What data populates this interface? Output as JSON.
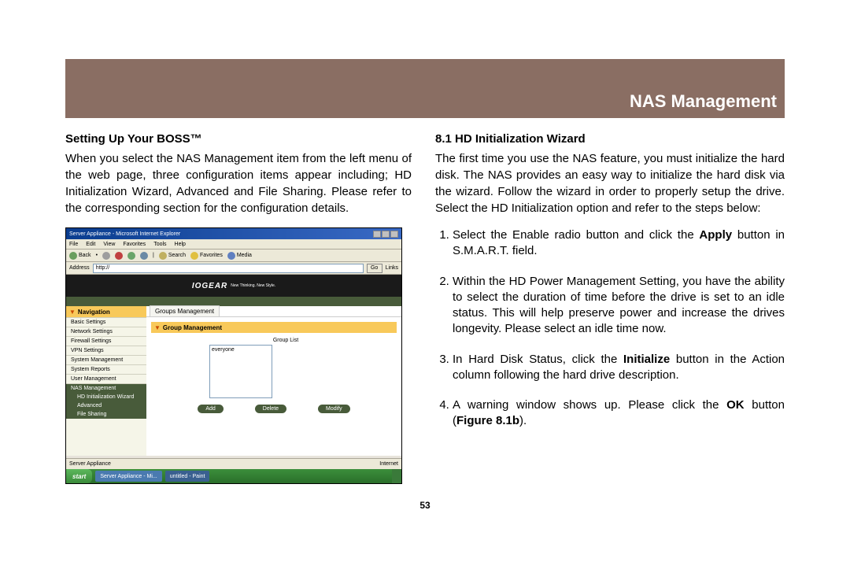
{
  "header": {
    "title": "NAS Management"
  },
  "left": {
    "heading": "Setting Up Your BOSS™",
    "paragraph": "When you select the NAS Management item from the left menu of the web page, three configuration items appear including; HD Initialization Wizard, Advanced and File Sharing. Please refer to the corresponding section for the configuration details."
  },
  "right": {
    "heading": "8.1 HD Initialization Wizard",
    "intro": "The first time you use the NAS feature, you must initialize the hard disk. The NAS provides an easy way to initialize the hard disk via the wizard. Follow the wizard in order to properly setup the drive. Select the HD Initialization option and refer to the steps below:",
    "steps": {
      "s1a": "Select the Enable radio button and click the ",
      "s1b": "Apply",
      "s1c": " button in S.M.A.R.T. field.",
      "s2": "Within the HD Power Management Setting, you have the ability to select the duration of time before the drive is set to an idle status. This will help preserve power and increase the drives longevity. Please select an idle time now.",
      "s3a": "In Hard Disk Status, click the ",
      "s3b": "Initialize",
      "s3c": " button in the Action column following the hard drive description.",
      "s4a": "A warning window shows up. Please click the ",
      "s4b": "OK",
      "s4c": " button (",
      "s4d": "Figure 8.1b",
      "s4e": ")."
    }
  },
  "screenshot": {
    "titlebar": "Server Appliance - Microsoft Internet Explorer",
    "menu": {
      "file": "File",
      "edit": "Edit",
      "view": "View",
      "favorites": "Favorites",
      "tools": "Tools",
      "help": "Help"
    },
    "toolbar": {
      "back": "Back",
      "search": "Search",
      "favorites": "Favorites",
      "media": "Media"
    },
    "address_label": "Address",
    "address_value": "http://",
    "go": "Go",
    "links": "Links",
    "banner": "IOGEAR",
    "banner_sub": "New Thinking. New Style.",
    "nav_header": "Navigation",
    "nav_items": {
      "basic": "Basic Settings",
      "network": "Network Settings",
      "firewall": "Firewall Settings",
      "vpn": "VPN Settings",
      "system": "System Management",
      "reports": "System Reports",
      "user": "User Management",
      "nas": "NAS Management"
    },
    "sub_nav": {
      "hd": "HD Initialization Wizard",
      "advanced": "Advanced",
      "fs": "File Sharing"
    },
    "tab": "Groups Management",
    "group_header": "Group Management",
    "group_list_label": "Group List",
    "group_item": "everyone",
    "buttons": {
      "add": "Add",
      "delete": "Delete",
      "modify": "Modify"
    },
    "status_left": "Server Appliance",
    "status_right": "Internet",
    "start": "start",
    "task1": "Server Appliance - Mi...",
    "task2": "untitled - Paint"
  },
  "page_number": "53"
}
